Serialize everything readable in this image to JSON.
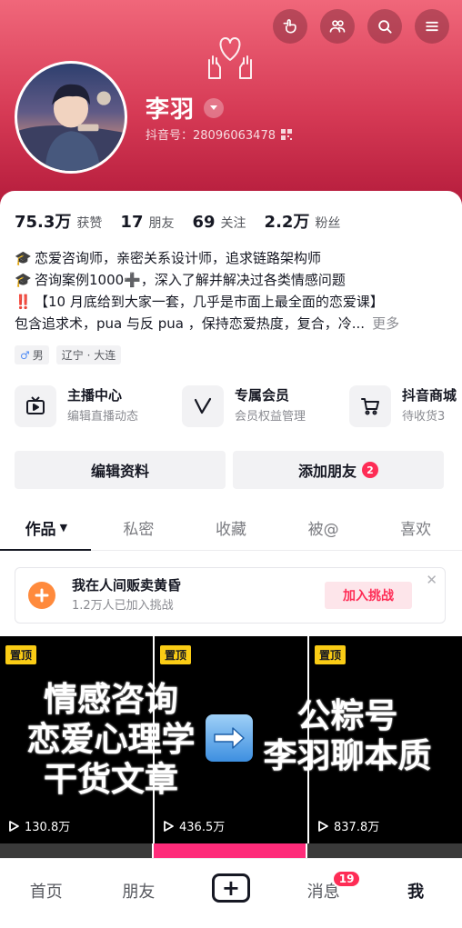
{
  "header": {
    "top_icons": [
      "gesture-icon",
      "friends-icon",
      "search-icon",
      "menu-icon"
    ],
    "decor_icon": "heart-hands-icon",
    "name": "李羽",
    "uid": "抖音号：28096063478"
  },
  "stats": [
    {
      "num": "75.3万",
      "label": "获赞"
    },
    {
      "num": "17",
      "label": "朋友"
    },
    {
      "num": "69",
      "label": "关注"
    },
    {
      "num": "2.2万",
      "label": "粉丝"
    }
  ],
  "bio": {
    "line1": "恋爱咨询师，亲密关系设计师，追求链路架构师",
    "line2": "咨询案例1000➕，深入了解并解决过各类情感问题",
    "line3": "【10 月底给到大家一套，几乎是市面上最全面的恋爱课】",
    "line4": "包含追求术，pua 与反 pua ，保持恋爱热度，复合，冷...",
    "more": "更多",
    "emoji1": "🎓",
    "emoji2": "🎓",
    "emoji3": "‼️"
  },
  "tags": {
    "gender": "男",
    "gender_symbol": "♂",
    "location": "辽宁 · 大连"
  },
  "services": [
    {
      "title": "主播中心",
      "sub": "编辑直播动态",
      "icon": "tv-icon"
    },
    {
      "title": "专属会员",
      "sub": "会员权益管理",
      "icon": "v-icon"
    },
    {
      "title": "抖音商城",
      "sub": "待收货3",
      "icon": "cart-icon"
    }
  ],
  "actions": {
    "edit": "编辑资料",
    "add_friend": "添加朋友",
    "add_friend_badge": "2"
  },
  "tabs": [
    "作品",
    "私密",
    "收藏",
    "被@",
    "喜欢"
  ],
  "tab_caret": "▼",
  "challenge": {
    "title": "我在人间贩卖黄昏",
    "sub": "1.2万人已加入挑战",
    "button": "加入挑战",
    "close": "✕"
  },
  "videos": [
    {
      "pin": "置顶",
      "views": "130.8万"
    },
    {
      "pin": "置顶",
      "views": "436.5万"
    },
    {
      "pin": "置顶",
      "views": "837.8万"
    }
  ],
  "overlay": {
    "left": [
      "情感咨询",
      "恋爱心理学",
      "干货文章"
    ],
    "right": [
      "公粽号",
      "李羽聊本质"
    ]
  },
  "nav": {
    "home": "首页",
    "friends": "朋友",
    "plus": "+",
    "messages": "消息",
    "messages_badge": "19",
    "me": "我"
  },
  "colors": {
    "accent": "#fe2c55",
    "header_top": "#f0677a",
    "header_bottom": "#b51c3c",
    "pin": "#facc15"
  }
}
